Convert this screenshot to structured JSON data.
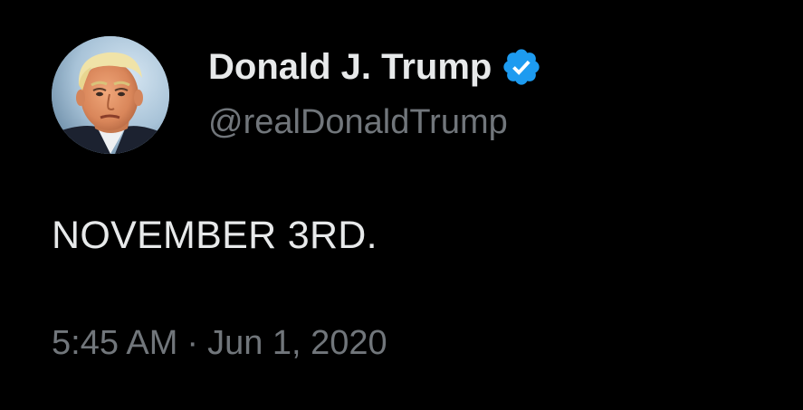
{
  "author": {
    "display_name": "Donald J. Trump",
    "handle": "@realDonaldTrump",
    "verified": true,
    "avatar": "profile-photo",
    "verified_icon": "verified-badge-icon",
    "verified_color": "#1d9bf0"
  },
  "tweet": {
    "text": "NOVEMBER 3RD.",
    "time": "5:45 AM",
    "separator": "·",
    "date": "Jun 1, 2020"
  },
  "colors": {
    "background": "#000000",
    "primary_text": "#e7e9ea",
    "secondary_text": "#71767b"
  }
}
